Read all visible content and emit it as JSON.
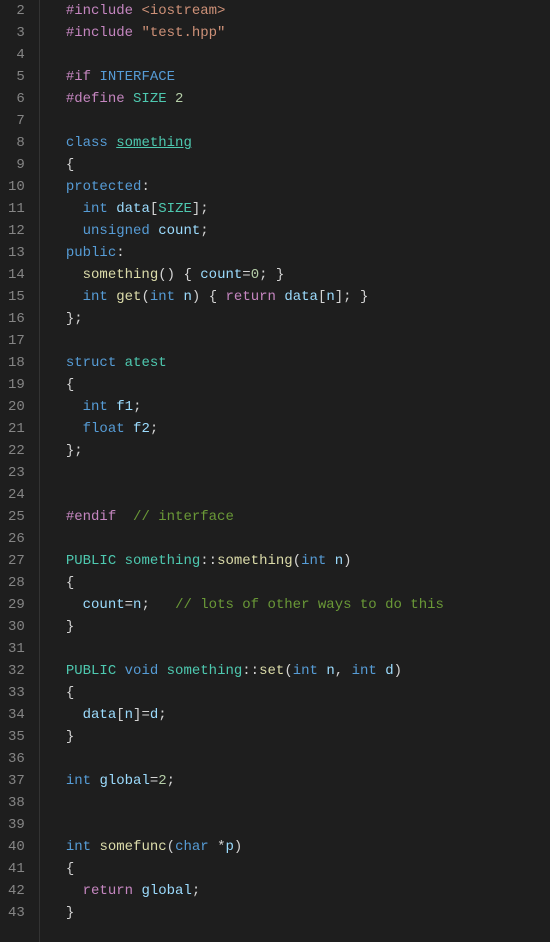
{
  "lines": [
    {
      "num": 2,
      "tokens": [
        [
          "pp",
          "#include"
        ],
        [
          "white",
          " "
        ],
        [
          "inc",
          "<iostream>"
        ]
      ]
    },
    {
      "num": 3,
      "tokens": [
        [
          "pp",
          "#include"
        ],
        [
          "white",
          " "
        ],
        [
          "inc",
          "\"test.hpp\""
        ]
      ]
    },
    {
      "num": 4,
      "tokens": []
    },
    {
      "num": 5,
      "tokens": [
        [
          "pp",
          "#if"
        ],
        [
          "white",
          " "
        ],
        [
          "macro",
          "INTERFACE"
        ]
      ]
    },
    {
      "num": 6,
      "tokens": [
        [
          "pp",
          "#define"
        ],
        [
          "white",
          " "
        ],
        [
          "def",
          "SIZE"
        ],
        [
          "white",
          " "
        ],
        [
          "num",
          "2"
        ]
      ]
    },
    {
      "num": 7,
      "tokens": []
    },
    {
      "num": 8,
      "tokens": [
        [
          "kw",
          "class"
        ],
        [
          "white",
          " "
        ],
        [
          "cls-u",
          "something"
        ]
      ]
    },
    {
      "num": 9,
      "tokens": [
        [
          "punc",
          "{"
        ]
      ]
    },
    {
      "num": 10,
      "tokens": [
        [
          "kw",
          "protected"
        ],
        [
          "punc",
          ":"
        ]
      ]
    },
    {
      "num": 11,
      "tokens": [
        [
          "white",
          "  "
        ],
        [
          "type",
          "int"
        ],
        [
          "white",
          " "
        ],
        [
          "var",
          "data"
        ],
        [
          "punc",
          "["
        ],
        [
          "def",
          "SIZE"
        ],
        [
          "punc",
          "];"
        ]
      ]
    },
    {
      "num": 12,
      "tokens": [
        [
          "white",
          "  "
        ],
        [
          "type",
          "unsigned"
        ],
        [
          "white",
          " "
        ],
        [
          "var",
          "count"
        ],
        [
          "punc",
          ";"
        ]
      ]
    },
    {
      "num": 13,
      "tokens": [
        [
          "kw",
          "public"
        ],
        [
          "punc",
          ":"
        ]
      ]
    },
    {
      "num": 14,
      "tokens": [
        [
          "white",
          "  "
        ],
        [
          "func",
          "something"
        ],
        [
          "punc",
          "() { "
        ],
        [
          "var",
          "count"
        ],
        [
          "op",
          "="
        ],
        [
          "num",
          "0"
        ],
        [
          "punc",
          "; }"
        ]
      ]
    },
    {
      "num": 15,
      "tokens": [
        [
          "white",
          "  "
        ],
        [
          "type",
          "int"
        ],
        [
          "white",
          " "
        ],
        [
          "func",
          "get"
        ],
        [
          "punc",
          "("
        ],
        [
          "type",
          "int"
        ],
        [
          "white",
          " "
        ],
        [
          "var",
          "n"
        ],
        [
          "punc",
          ") { "
        ],
        [
          "ctrl",
          "return"
        ],
        [
          "white",
          " "
        ],
        [
          "var",
          "data"
        ],
        [
          "punc",
          "["
        ],
        [
          "var",
          "n"
        ],
        [
          "punc",
          "]; }"
        ]
      ]
    },
    {
      "num": 16,
      "tokens": [
        [
          "punc",
          "};"
        ]
      ]
    },
    {
      "num": 17,
      "tokens": []
    },
    {
      "num": 18,
      "tokens": [
        [
          "kw",
          "struct"
        ],
        [
          "white",
          " "
        ],
        [
          "cls",
          "atest"
        ]
      ]
    },
    {
      "num": 19,
      "tokens": [
        [
          "punc",
          "{"
        ]
      ]
    },
    {
      "num": 20,
      "tokens": [
        [
          "white",
          "  "
        ],
        [
          "type",
          "int"
        ],
        [
          "white",
          " "
        ],
        [
          "var",
          "f1"
        ],
        [
          "punc",
          ";"
        ]
      ]
    },
    {
      "num": 21,
      "tokens": [
        [
          "white",
          "  "
        ],
        [
          "type",
          "float"
        ],
        [
          "white",
          " "
        ],
        [
          "var",
          "f2"
        ],
        [
          "punc",
          ";"
        ]
      ]
    },
    {
      "num": 22,
      "tokens": [
        [
          "punc",
          "};"
        ]
      ]
    },
    {
      "num": 23,
      "tokens": []
    },
    {
      "num": 24,
      "tokens": []
    },
    {
      "num": 25,
      "tokens": [
        [
          "pp",
          "#endif"
        ],
        [
          "white",
          "  "
        ],
        [
          "cmt",
          "// interface"
        ]
      ]
    },
    {
      "num": 26,
      "tokens": []
    },
    {
      "num": 27,
      "tokens": [
        [
          "def",
          "PUBLIC"
        ],
        [
          "white",
          " "
        ],
        [
          "cls",
          "something"
        ],
        [
          "punc",
          "::"
        ],
        [
          "func",
          "something"
        ],
        [
          "punc",
          "("
        ],
        [
          "type",
          "int"
        ],
        [
          "white",
          " "
        ],
        [
          "var",
          "n"
        ],
        [
          "punc",
          ")"
        ]
      ]
    },
    {
      "num": 28,
      "tokens": [
        [
          "punc",
          "{"
        ]
      ]
    },
    {
      "num": 29,
      "tokens": [
        [
          "white",
          "  "
        ],
        [
          "var",
          "count"
        ],
        [
          "op",
          "="
        ],
        [
          "var",
          "n"
        ],
        [
          "punc",
          ";   "
        ],
        [
          "cmt",
          "// lots of other ways to do this"
        ]
      ]
    },
    {
      "num": 30,
      "tokens": [
        [
          "punc",
          "}"
        ]
      ]
    },
    {
      "num": 31,
      "tokens": []
    },
    {
      "num": 32,
      "tokens": [
        [
          "def",
          "PUBLIC"
        ],
        [
          "white",
          " "
        ],
        [
          "type",
          "void"
        ],
        [
          "white",
          " "
        ],
        [
          "cls",
          "something"
        ],
        [
          "punc",
          "::"
        ],
        [
          "func",
          "set"
        ],
        [
          "punc",
          "("
        ],
        [
          "type",
          "int"
        ],
        [
          "white",
          " "
        ],
        [
          "var",
          "n"
        ],
        [
          "punc",
          ", "
        ],
        [
          "type",
          "int"
        ],
        [
          "white",
          " "
        ],
        [
          "var",
          "d"
        ],
        [
          "punc",
          ")"
        ]
      ]
    },
    {
      "num": 33,
      "tokens": [
        [
          "punc",
          "{"
        ]
      ]
    },
    {
      "num": 34,
      "tokens": [
        [
          "white",
          "  "
        ],
        [
          "var",
          "data"
        ],
        [
          "punc",
          "["
        ],
        [
          "var",
          "n"
        ],
        [
          "punc",
          "]"
        ],
        [
          "op",
          "="
        ],
        [
          "var",
          "d"
        ],
        [
          "punc",
          ";"
        ]
      ]
    },
    {
      "num": 35,
      "tokens": [
        [
          "punc",
          "}"
        ]
      ]
    },
    {
      "num": 36,
      "tokens": []
    },
    {
      "num": 37,
      "tokens": [
        [
          "type",
          "int"
        ],
        [
          "white",
          " "
        ],
        [
          "var",
          "global"
        ],
        [
          "op",
          "="
        ],
        [
          "num",
          "2"
        ],
        [
          "punc",
          ";"
        ]
      ]
    },
    {
      "num": 38,
      "tokens": []
    },
    {
      "num": 39,
      "tokens": []
    },
    {
      "num": 40,
      "tokens": [
        [
          "type",
          "int"
        ],
        [
          "white",
          " "
        ],
        [
          "func",
          "somefunc"
        ],
        [
          "punc",
          "("
        ],
        [
          "type",
          "char"
        ],
        [
          "white",
          " "
        ],
        [
          "op",
          "*"
        ],
        [
          "var",
          "p"
        ],
        [
          "punc",
          ")"
        ]
      ]
    },
    {
      "num": 41,
      "tokens": [
        [
          "punc",
          "{"
        ]
      ]
    },
    {
      "num": 42,
      "tokens": [
        [
          "white",
          "  "
        ],
        [
          "ctrl",
          "return"
        ],
        [
          "white",
          " "
        ],
        [
          "var",
          "global"
        ],
        [
          "punc",
          ";"
        ]
      ]
    },
    {
      "num": 43,
      "tokens": [
        [
          "punc",
          "}"
        ]
      ]
    }
  ]
}
